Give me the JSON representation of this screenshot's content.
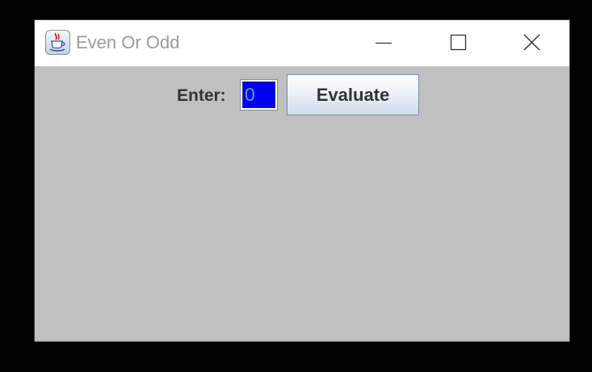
{
  "window": {
    "title": "Even Or Odd",
    "app_icon": "java-cup-icon",
    "controls": {
      "minimize_icon": "minimize-icon",
      "maximize_icon": "maximize-icon",
      "close_icon": "close-icon"
    }
  },
  "form": {
    "enter_label": "Enter:",
    "number_value": "0",
    "evaluate_label": "Evaluate"
  },
  "colors": {
    "content_background": "#c0c0c0",
    "input_selection": "#0000f0",
    "input_text": "#46a0ff",
    "title_text": "#9a9a9a"
  }
}
